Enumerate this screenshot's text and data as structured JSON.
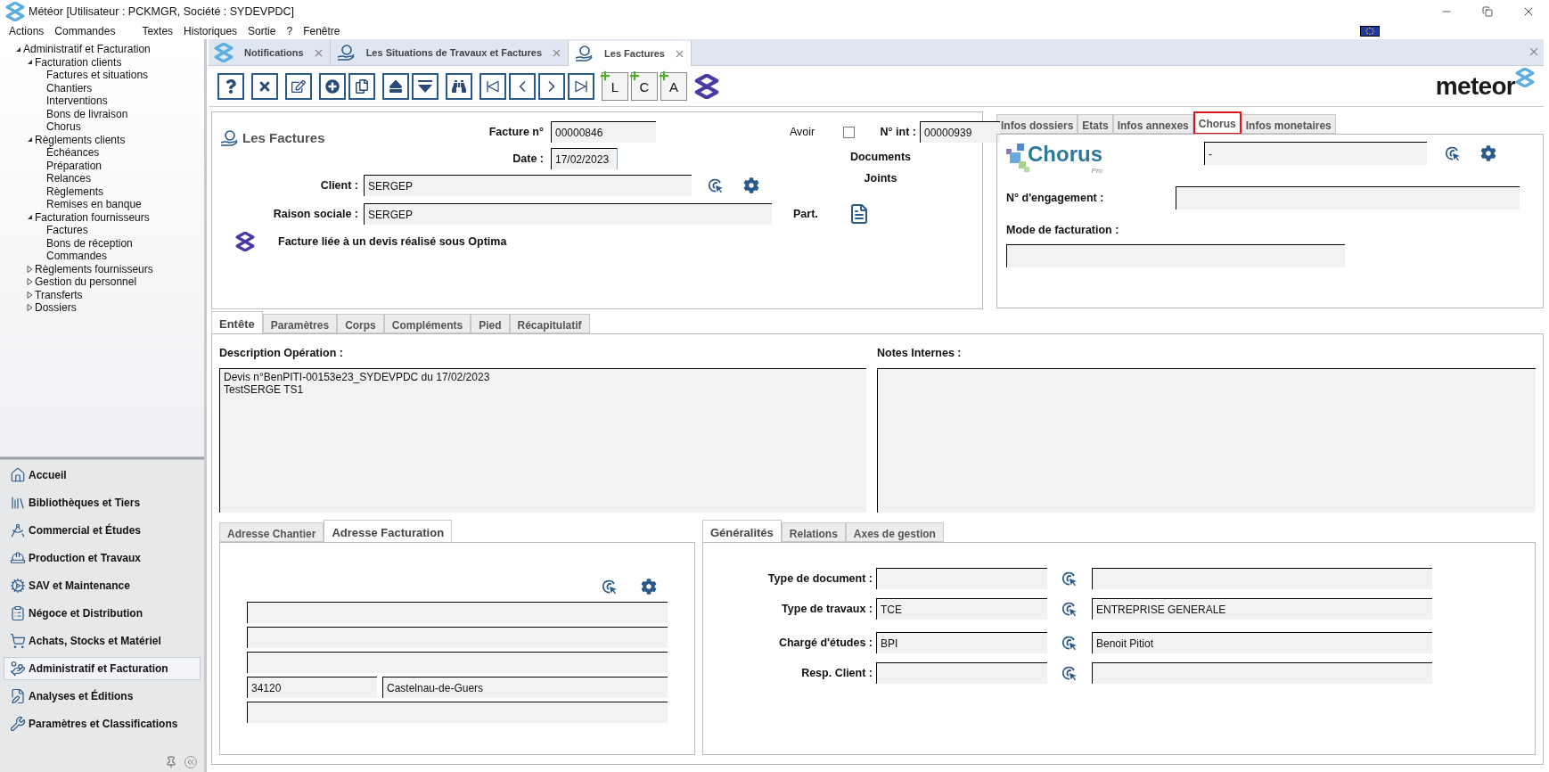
{
  "window": {
    "title": "Météor [Utilisateur : PCKMGR, Société : SYDEVPDC]"
  },
  "menu": [
    "Actions",
    "Commandes",
    "Textes",
    "Historiques",
    "Sortie",
    "?",
    "Fenêtre"
  ],
  "tree": [
    {
      "label": "Administratif et Facturation",
      "expanded": true,
      "children": [
        {
          "label": "Facturation clients",
          "expanded": true,
          "children": [
            {
              "label": "Factures et situations"
            },
            {
              "label": "Chantiers"
            },
            {
              "label": "Interventions"
            },
            {
              "label": "Bons de livraison"
            },
            {
              "label": "Chorus"
            }
          ]
        },
        {
          "label": "Règlements clients",
          "expanded": true,
          "children": [
            {
              "label": "Échéances"
            },
            {
              "label": "Préparation"
            },
            {
              "label": "Relances"
            },
            {
              "label": "Règlements"
            },
            {
              "label": "Remises en banque"
            }
          ]
        },
        {
          "label": "Facturation fournisseurs",
          "expanded": true,
          "children": [
            {
              "label": "Factures"
            },
            {
              "label": "Bons de réception"
            },
            {
              "label": "Commandes"
            }
          ]
        },
        {
          "label": "Règlements fournisseurs",
          "expanded": false
        },
        {
          "label": "Gestion du personnel",
          "expanded": false
        },
        {
          "label": "Transferts",
          "expanded": false
        },
        {
          "label": "Dossiers",
          "expanded": false
        }
      ]
    }
  ],
  "nav": [
    {
      "label": "Accueil",
      "selected": false
    },
    {
      "label": "Bibliothèques et Tiers",
      "selected": false
    },
    {
      "label": "Commercial et Études",
      "selected": false
    },
    {
      "label": "Production et Travaux",
      "selected": false
    },
    {
      "label": "SAV et Maintenance",
      "selected": false
    },
    {
      "label": "Négoce et Distribution",
      "selected": false
    },
    {
      "label": "Achats, Stocks et Matériel",
      "selected": false
    },
    {
      "label": "Administratif et Facturation",
      "selected": true
    },
    {
      "label": "Analyses et Éditions",
      "selected": false
    },
    {
      "label": "Paramètres et Classifications",
      "selected": false
    }
  ],
  "doc_tabs": [
    {
      "label": "Notifications",
      "selected": false
    },
    {
      "label": "Les Situations de Travaux et Factures",
      "selected": false
    },
    {
      "label": "Les Factures",
      "selected": true
    }
  ],
  "toolbar": {
    "letter_buttons": [
      "L",
      "C",
      "A"
    ]
  },
  "logo": "meteor",
  "form": {
    "title": "Les Factures",
    "invoice_label": "Facture n°",
    "invoice_no": "00000846",
    "credit_label": "Avoir",
    "credit_checked": false,
    "internal_label": "N° int :",
    "internal_no": "00000939",
    "date_label": "Date :",
    "date": "17/02/2023",
    "documents_label": "Documents Joints",
    "client_label": "Client :",
    "client": "SERGEP",
    "company_label": "Raison sociale :",
    "company": "SERGEP",
    "part_label": "Part.",
    "optima_note": "Facture liée à un devis réalisé sous Optima"
  },
  "info_tabs": [
    {
      "label": "Infos dossiers",
      "selected": false
    },
    {
      "label": "Etats",
      "selected": false
    },
    {
      "label": "Infos annexes",
      "selected": false
    },
    {
      "label": "Chorus",
      "selected": true
    },
    {
      "label": "Infos monetaires",
      "selected": false
    }
  ],
  "chorus": {
    "logo_text": "Chorus",
    "logo_sub": "Pro",
    "value": "-",
    "engagement_label": "N° d'engagement :",
    "mode_label": "Mode de facturation :"
  },
  "main_tabs": [
    {
      "label": "Entête",
      "selected": true
    },
    {
      "label": "Paramètres",
      "selected": false
    },
    {
      "label": "Corps",
      "selected": false
    },
    {
      "label": "Compléments",
      "selected": false
    },
    {
      "label": "Pied",
      "selected": false
    },
    {
      "label": "Récapitulatif",
      "selected": false
    }
  ],
  "description": {
    "label": "Description Opération :",
    "lines": [
      "Devis n°BenPITI-00153e23_SYDEVPDC du 17/02/2023",
      "TestSERGE TS1"
    ]
  },
  "notes": {
    "label": "Notes Internes :"
  },
  "address_tabs": [
    {
      "label": "Adresse Chantier",
      "selected": false
    },
    {
      "label": "Adresse Facturation",
      "selected": true
    }
  ],
  "address_lines": [
    {
      "kind": "single"
    },
    {
      "kind": "single"
    },
    {
      "kind": "single"
    },
    {
      "kind": "split",
      "postal_code": "34120",
      "city": "Castelnau-de-Guers"
    },
    {
      "kind": "single"
    }
  ],
  "general_tabs": [
    {
      "label": "Généralités",
      "selected": true
    },
    {
      "label": "Relations",
      "selected": false
    },
    {
      "label": "Axes de gestion",
      "selected": false
    }
  ],
  "general_rows": [
    {
      "label": "Type de document :"
    },
    {
      "label": "Type de travaux :",
      "code": "TCE",
      "value": "ENTREPRISE GENERALE"
    },
    {
      "label": "Chargé d'études :",
      "code": "BPI",
      "value": "Benoit Pitiot"
    },
    {
      "label": "Resp. Client :"
    }
  ]
}
